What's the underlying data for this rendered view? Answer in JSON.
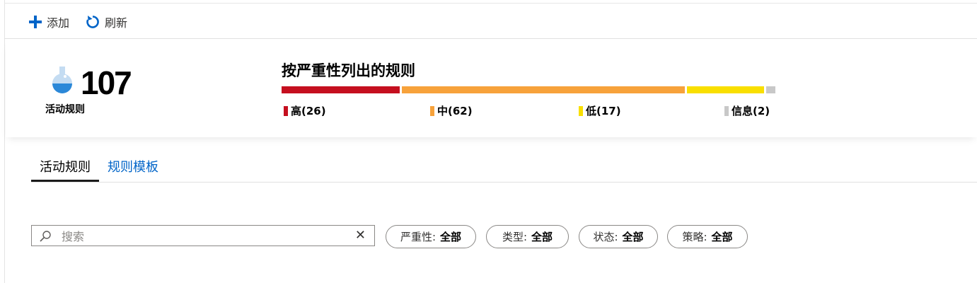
{
  "toolbar": {
    "add_label": "添加",
    "refresh_label": "刷新"
  },
  "summary": {
    "active_rule_count": "107",
    "active_rule_label": "活动规则",
    "severity_title": "按严重性列出的规则",
    "severity": [
      {
        "label": "高(26)",
        "count": 26,
        "color": "#c50f1f"
      },
      {
        "label": "中(62)",
        "count": 62,
        "color": "#f7a23b"
      },
      {
        "label": "低(17)",
        "count": 17,
        "color": "#f9df00"
      },
      {
        "label": "信息(2)",
        "count": 2,
        "color": "#c8c8c8"
      }
    ]
  },
  "tabs": [
    {
      "label": "活动规则",
      "active": true
    },
    {
      "label": "规则模板",
      "active": false
    }
  ],
  "search": {
    "placeholder": "搜索",
    "value": ""
  },
  "filters": [
    {
      "name": "严重性:",
      "value": "全部"
    },
    {
      "name": "类型:",
      "value": "全部"
    },
    {
      "name": "状态:",
      "value": "全部"
    },
    {
      "name": "策略:",
      "value": "全部"
    }
  ],
  "colors": {
    "accent": "#0064c8",
    "tab_link": "#0064c8"
  }
}
